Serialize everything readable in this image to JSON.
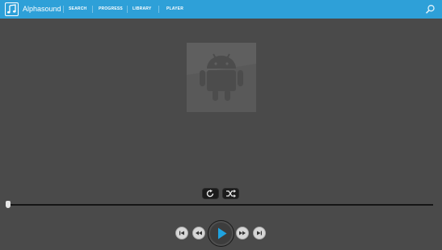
{
  "app": {
    "title": "Alphasound",
    "accent": "#2ea0d8"
  },
  "nav": {
    "items": [
      "SEARCH",
      "PROGRESS",
      "LIBRARY",
      "PLAYER"
    ]
  },
  "icons": {
    "logo": "music-note-icon",
    "search": "search-icon",
    "album_art": "android-placeholder-icon",
    "repeat": "repeat-icon",
    "shuffle": "shuffle-icon",
    "skip_previous": "skip-previous-icon",
    "rewind": "rewind-icon",
    "play": "play-icon",
    "fast_forward": "fast-forward-icon",
    "skip_next": "skip-next-icon"
  },
  "player": {
    "progress": 0.0,
    "play_color": "#1fa3e0"
  }
}
